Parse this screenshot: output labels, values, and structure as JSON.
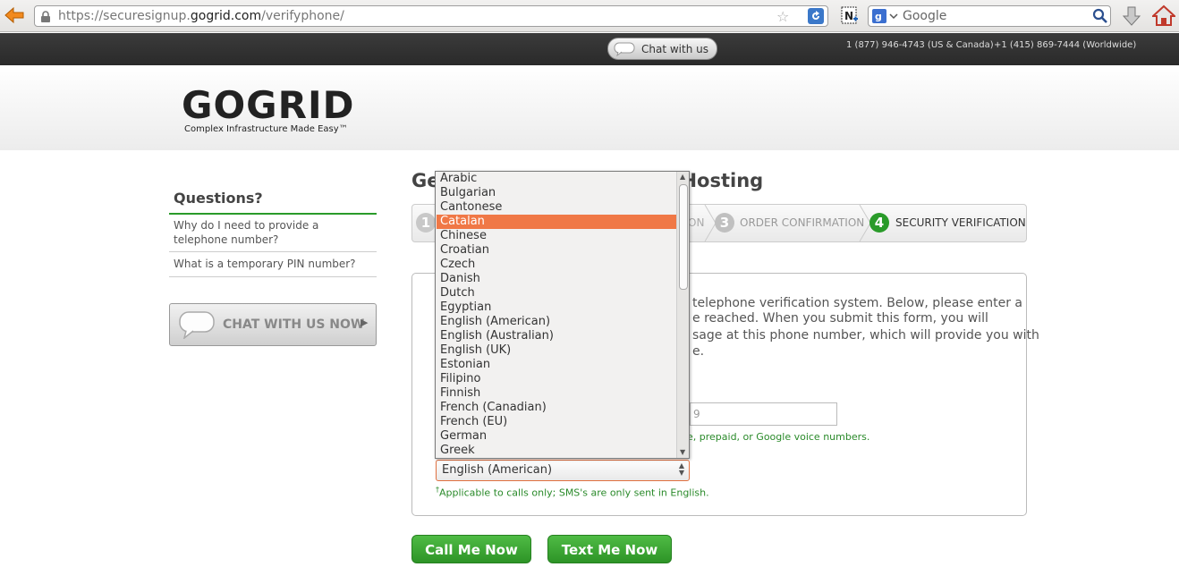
{
  "browser": {
    "url_prefix": "https://securesignup.",
    "url_domain": "gogrid.com",
    "url_path": "/verifyphone/",
    "search_placeholder": "Google"
  },
  "topbar": {
    "chat_label": "Chat with us",
    "phone_us": "1 (877) 946-4743 (US & Canada)",
    "phone_ww": "+1 (415) 869-7444 (Worldwide)"
  },
  "header": {
    "logo_text": "GOGRID",
    "logo_tagline": "Complex Infrastructure Made Easy™"
  },
  "sidebar": {
    "title": "Questions?",
    "faq": [
      "Why do I need to provide a telephone number?",
      "What is a temporary PIN number?"
    ],
    "chat_now_label": "CHAT WITH US NOW"
  },
  "main": {
    "title_left": "Ge",
    "title_right": "Hosting",
    "steps": {
      "step1_num": "1",
      "step2_label": "ON",
      "step3_num": "3",
      "step3_label": "ORDER CONFIRMATION",
      "step4_num": "4",
      "step4_label": "SECURITY VERIFICATION"
    },
    "intro_lines": [
      "telephone verification system. Below, please enter a",
      "e reached. When you submit this form, you will",
      "sage at this phone number, which will provide you with",
      "e."
    ],
    "phone_value": "9",
    "phone_note": "e, prepaid, or Google voice numbers.",
    "language_selected": "English (American)",
    "language_note": "Applicable to calls only; SMS's are only sent in English.",
    "language_note_mark": "†",
    "call_button": "Call Me Now",
    "text_button": "Text Me Now"
  },
  "dropdown": {
    "highlighted": "Catalan",
    "options": [
      "Arabic",
      "Bulgarian",
      "Cantonese",
      "Catalan",
      "Chinese",
      "Croatian",
      "Czech",
      "Danish",
      "Dutch",
      "Egyptian",
      "English (American)",
      "English (Australian)",
      "English (UK)",
      "Estonian",
      "Filipino",
      "Finnish",
      "French (Canadian)",
      "French (EU)",
      "German",
      "Greek"
    ]
  },
  "colors": {
    "accent_green": "#2a9b2a",
    "highlight_orange": "#f07846",
    "topbar_dark": "#2f2f2f"
  }
}
